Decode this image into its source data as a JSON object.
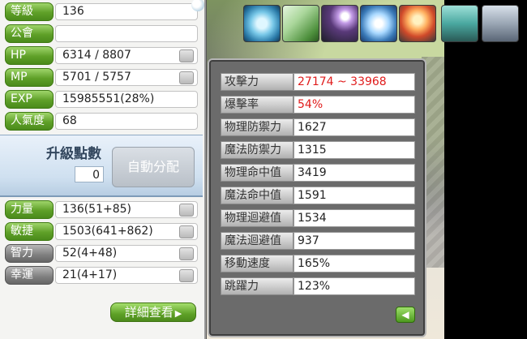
{
  "basic": {
    "rows": [
      {
        "label": "等級",
        "value": "136"
      },
      {
        "label": "公會",
        "value": ""
      },
      {
        "label": "HP",
        "value": "6314 / 8807"
      },
      {
        "label": "MP",
        "value": "5701 / 5757"
      },
      {
        "label": "EXP",
        "value": "15985551(28%)"
      },
      {
        "label": "人氣度",
        "value": "68"
      }
    ]
  },
  "ap": {
    "title": "升級點數",
    "points": "0",
    "auto_button": "自動分配"
  },
  "stats": [
    {
      "label": "力量",
      "value": "136(51+85)"
    },
    {
      "label": "敏捷",
      "value": "1503(641+862)"
    },
    {
      "label": "智力",
      "value": "52(4+48)"
    },
    {
      "label": "幸運",
      "value": "21(4+17)"
    }
  ],
  "detail_button": "詳細查看",
  "detail": {
    "rows": [
      {
        "label": "攻擊力",
        "value": "27174 ~ 33968"
      },
      {
        "label": "爆擊率",
        "value": "54%"
      },
      {
        "label": "物理防禦力",
        "value": "1627"
      },
      {
        "label": "魔法防禦力",
        "value": "1315"
      },
      {
        "label": "物理命中值",
        "value": "3419"
      },
      {
        "label": "魔法命中值",
        "value": "1591"
      },
      {
        "label": "物理迴避值",
        "value": "1534"
      },
      {
        "label": "魔法迴避值",
        "value": "937"
      },
      {
        "label": "移動速度",
        "value": "165%"
      },
      {
        "label": "跳躍力",
        "value": "123%"
      }
    ],
    "highlight_color": "#e01c1c"
  },
  "skill_icons": [
    "wind-spiral-skill-icon",
    "arrow-vine-skill-icon",
    "orb-ring-skill-icon",
    "ice-burst-skill-icon",
    "fire-gear-skill-icon",
    "crystal-shrine-skill-icon",
    "potion-bottle-skill-icon"
  ],
  "colors": {
    "label_green": "#5fa028",
    "label_grey": "#7e7e7e",
    "detail_bg": "#6b6b6b"
  }
}
